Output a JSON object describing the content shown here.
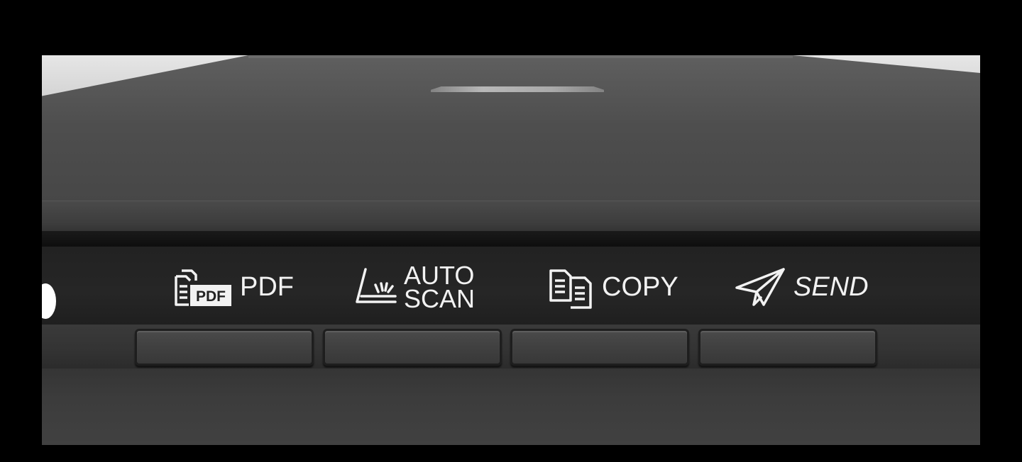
{
  "device": {
    "kind": "flatbed scanner control panel",
    "status_led": "on"
  },
  "buttons": [
    {
      "id": "pdf",
      "icon": "pdf-document-icon",
      "label": "PDF"
    },
    {
      "id": "auto-scan",
      "icon": "auto-scan-icon",
      "label_line1": "AUTO",
      "label_line2": "SCAN"
    },
    {
      "id": "copy",
      "icon": "copy-documents-icon",
      "label": "COPY"
    },
    {
      "id": "send",
      "icon": "paper-plane-icon",
      "label": "SEND"
    }
  ],
  "colors": {
    "body": "#3f3f3f",
    "panel": "#242424",
    "label_text": "#f2f2f2",
    "led": "#ffffff"
  }
}
